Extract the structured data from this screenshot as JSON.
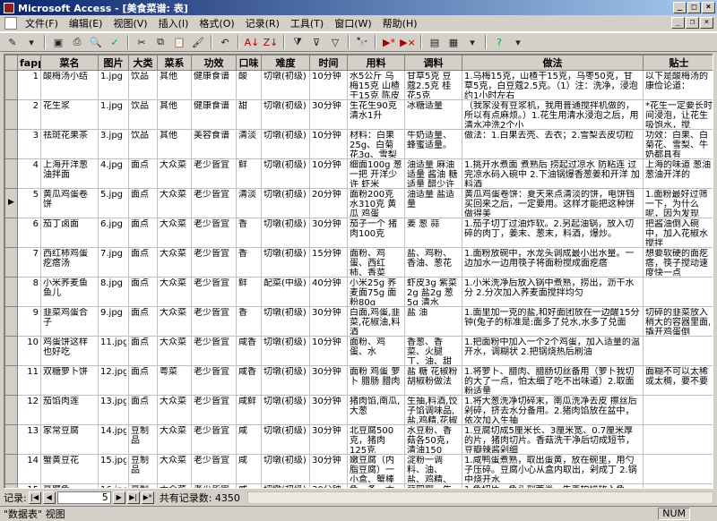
{
  "titlebar": {
    "title": "Microsoft Access - [美食菜谱: 表]"
  },
  "menu": [
    "文件(F)",
    "编辑(E)",
    "视图(V)",
    "插入(I)",
    "格式(O)",
    "记录(R)",
    "工具(T)",
    "窗口(W)",
    "帮助(H)"
  ],
  "columns": [
    "fapp",
    "菜名",
    "图片",
    "大类",
    "菜系",
    "功效",
    "口味",
    "难度",
    "时间",
    "用料",
    "调料",
    "做法",
    "贴士"
  ],
  "rows": [
    [
      "1",
      "酸梅汤小结",
      "1.jpg",
      "饮品",
      "其他",
      "健康食谱",
      "酸",
      "切墩(初级)",
      "10分钟",
      "水5公斤 乌梅15克 山楂干15克 陈皮5克 甘草5",
      "甘草5克 豆蔻2.5克 桂花5克",
      "1.乌梅15克，山楂干15克，乌枣50克，甘草5克，白豆蔻2.5克。（1）注：洗净，浸泡约1小时左右",
      "以下是酸梅汤的康俭论道："
    ],
    [
      "2",
      "花生浆",
      "1.jpg",
      "饮品",
      "其他",
      "健康食谱",
      "甜",
      "切墩(初级)",
      "30分钟",
      "生花生90克 清水1升",
      "冰糖适量",
      "（我家没有豆浆机，我用普通搅拌机做的，所以有点麻烦。）1.花生用清水浸泡之后，用清水冲洗2个小",
      "*花生一定要长时间浸泡，让花生吸饱水，搅"
    ],
    [
      "3",
      "祛斑花果茶",
      "3.jpg",
      "饮品",
      "其他",
      "美容食谱",
      "清淡",
      "切墩(初级)",
      "10分钟",
      "材料：白果25g、白菊花3g、雪梨1个",
      "牛奶适量、蜂蜜适量。",
      "做法：1.白果去壳、去衣；2.雪梨去皮切粒",
      "功效：白果、白菊花、雪梨、牛奶都具有"
    ],
    [
      "4",
      "上海开洋葱油拌面",
      "4.jpg",
      "面点",
      "大众菜",
      "老少皆宜",
      "鲜",
      "切墩(初级)",
      "10分钟",
      "细面100g 葱一把 开洋少许 虾米",
      "油适量 麻油适量 酱油 糖适量 醋少许",
      "1.挑开水煮面 煮熟后 捞起过凉水 防粘连 过完凉水码入碗中 2.下油锅爆香葱姜和开洋 加料酒",
      "上海的味道 葱油葱油开洋的"
    ],
    [
      "5",
      "黄瓜鸡蛋卷饼",
      "5.jpg",
      "面点",
      "大众菜",
      "老少皆宜",
      "清淡",
      "切墩(初级)",
      "20分钟",
      "面粉200克 水310克 黄瓜 鸡蛋",
      "油适量 盐适量",
      "黄瓜鸡蛋卷饼：夏天来点清淡的饼，电饼铛买回来之后，一定要用。这样才能把这种饼做得美",
      "1.面粉最好过筛一下，为什么呢，因为发现"
    ],
    [
      "6",
      "茄丁卤面",
      "6.jpg",
      "面点",
      "大众菜",
      "老少皆宜",
      "香",
      "切墩(初级)",
      "30分钟",
      "茄子一个 猪肉100克",
      "姜 葱 蒜",
      "1.茄子切丁过油炸软。2.另起油锅，放入切碎的肉丁，姜末、葱末，料酒，爆炒。",
      "把酱油倒入碗中，加入花椒水搅拌"
    ],
    [
      "7",
      "西红柿鸡蛋疙瘩汤",
      "7.jpg",
      "面点",
      "大众菜",
      "老少皆宜",
      "香",
      "切墩(初级)",
      "15分钟",
      "面粉、鸡蛋、西红柿、香菜",
      "盐、鸡粉、香油、葱花",
      "1.面粉放碗中，水龙头调成最小出水量。一边加水一边用筷子将面粉搅成面疙瘩",
      "想要软硬的面疙瘩，筷子搅动速度快一点"
    ],
    [
      "8",
      "小米荞麦鱼鱼儿",
      "8.jpg",
      "面点",
      "大众菜",
      "老少皆宜",
      "鲜",
      "配菜(中级)",
      "40分钟",
      "小米25g 荞麦面75g 面粉80g",
      "虾皮3g 紫菜2g 盐2g 葱5g 清水600ml 食用油少",
      "1.小米洗净后放入锅中煮熟，捞出，沥干水分 2.分次加入荞麦面搅拌均匀",
      ""
    ],
    [
      "9",
      "韭菜鸡蛋合子",
      "9.jpg",
      "面点",
      "大众菜",
      "老少皆宜",
      "香",
      "切墩(初级)",
      "30分钟",
      "白面,鸡蛋,韭菜,花椒油,料酒",
      "盐 油",
      "1.面里加一克的盐,和好面团放在一边醒15分钟(兔子的标准是:面多了兑水,水多了兑面",
      "切碎的韭菜放入稍大的容器里面,撬开鸡蛋倒"
    ],
    [
      "10",
      "鸡蛋饼这样也好吃",
      "11.jpg",
      "面点",
      "大众菜",
      "老少皆宜",
      "咸香",
      "切墩(初级)",
      "10分钟",
      "面粉、鸡蛋、水",
      "香葱、香菜、火腿丁、油、甜面酱、辣椒酱",
      "1.把面粉中加入一个2个鸡蛋，加入适量的温开水，调糊状 2.把锅烧热后刷油",
      ""
    ],
    [
      "11",
      "双糖萝卜饼",
      "12.jpg",
      "面点",
      "粤菜",
      "老少皆宜",
      "咸香",
      "切墩(初级)",
      "30分钟",
      "面粉 鸡蛋 萝卜 腊肠 腊肉",
      "盐 糖 花椒粉 胡椒粉做法",
      "1.将萝卜、腊肉、腊肠切丝备用（萝卜我切的大了一点，怕太细了吃不出味道）2.取面粉适量",
      "面糊不可以太稀或太稠，要不要"
    ],
    [
      "12",
      "茄馅肉莲",
      "13.jpg",
      "面点",
      "大众菜",
      "老少皆宜",
      "咸鲜",
      "切墩(初级)",
      "30分钟",
      "猪肉馅,南瓜,大葱",
      "生抽,料酒,饺子馅调味品,盐,鸡精,花椒粉,香油",
      "1.将大葱洗净切碎末，南瓜洗净去皮 擦丝后剁碎，挤去水分备用。2.猪肉馅放在盆中，依次加入生抽",
      ""
    ],
    [
      "13",
      "家常豆腐",
      "14.jpg",
      "豆制品",
      "大众菜",
      "老少皆宜",
      "咸",
      "切墩(初级)",
      "30分钟",
      "北豆腐500克，猪肉125克",
      "水豆粉、香菇各50克，清油150克，豆瓣辣酱",
      "1.豆腐切成5厘米长、3厘米宽、0.7厘米厚的片，猪肉切片。香菇洗干净后切成短节，豆瓣辣酱剁细",
      ""
    ],
    [
      "14",
      "蟹黄豆花",
      "15.jpg",
      "豆制品",
      "大众菜",
      "老少皆宜",
      "咸",
      "切墩(初级)",
      "30分钟",
      "嫩豆腐（内脂豆腐）一小盒、蟹棒四根、鲜蛋黄",
      "淀粉一调料、油、盐、鸡精、麻油",
      "1.咸鸭蛋煮熟，取出蛋黄，放在碗里，用勺子压碎。豆腐小心从盒内取出，剁成丁 2.锅中烧开水",
      ""
    ],
    [
      "15",
      "豆腐鱼",
      "16.jpg",
      "豆制品",
      "大众菜",
      "老少皆宜",
      "咸",
      "切墩(初级)",
      "30分钟",
      "鱼一条、大葱一大根、豆腐一块",
      "蒜四瓣、生姜两块、胡椒、味精、盐、干淀粉",
      "1.鱼切片，鱼头剖两半，生姜拍烂放入鱼中，加入干淀粉调均匀；大葱切段，豆腐切块，蒜切片。",
      ""
    ],
    [
      "16",
      "豆腐拌好",
      "17.jpg",
      "豆制品",
      "西餐",
      "老少皆宜",
      "咸",
      "切墩(初级)",
      "10分钟",
      "嫩豆腐1盒，山药",
      "调味料酱油5汤匙",
      "1.铺上草莓；2.",
      ""
    ]
  ],
  "navbar": {
    "label": "记录:",
    "current": "5",
    "count_text": "共有记录数: 4350"
  },
  "status": {
    "view": "\"数据表\" 视图",
    "mode": "NUM"
  }
}
